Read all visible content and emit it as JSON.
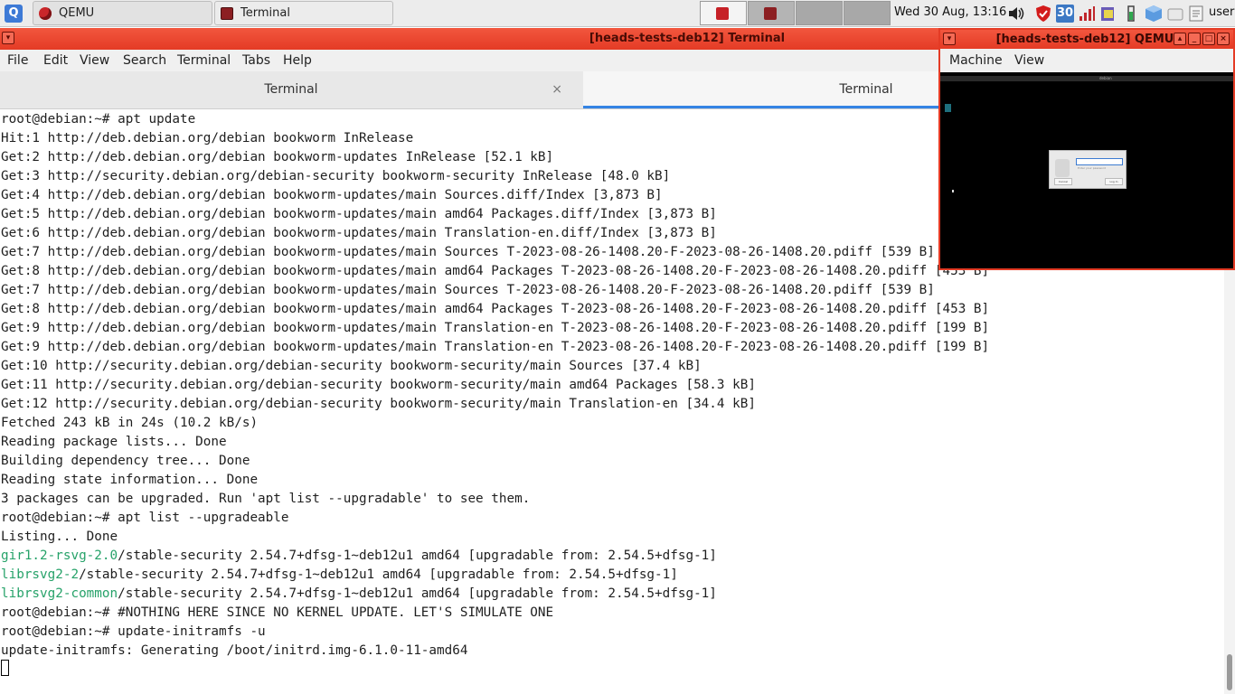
{
  "taskbar": {
    "tasks": [
      {
        "label": "QEMU",
        "icon": "qemu-icon"
      },
      {
        "label": "Terminal",
        "icon": "terminal-icon"
      }
    ],
    "clock": "Wed 30 Aug, 13:16",
    "tray_calendar_day": "30",
    "username": "user",
    "tray_icons": [
      "volume-icon",
      "shield-icon",
      "calendar-icon",
      "signal-bars-icon",
      "clipboard-icon",
      "battery-icon",
      "cube-icon",
      "drive-icon",
      "notes-icon"
    ]
  },
  "terminal": {
    "title": "[heads-tests-deb12] Terminal",
    "menu": [
      "File",
      "Edit",
      "View",
      "Search",
      "Terminal",
      "Tabs",
      "Help"
    ],
    "tabs": [
      {
        "label": "Terminal",
        "close": "×"
      },
      {
        "label": "Terminal"
      }
    ],
    "lines": [
      {
        "text": "root@debian:~# apt update"
      },
      {
        "text": "Hit:1 http://deb.debian.org/debian bookworm InRelease"
      },
      {
        "text": "Get:2 http://deb.debian.org/debian bookworm-updates InRelease [52.1 kB]"
      },
      {
        "text": "Get:3 http://security.debian.org/debian-security bookworm-security InRelease [48.0 kB]"
      },
      {
        "text": "Get:4 http://deb.debian.org/debian bookworm-updates/main Sources.diff/Index [3,873 B]"
      },
      {
        "text": "Get:5 http://deb.debian.org/debian bookworm-updates/main amd64 Packages.diff/Index [3,873 B]"
      },
      {
        "text": "Get:6 http://deb.debian.org/debian bookworm-updates/main Translation-en.diff/Index [3,873 B]"
      },
      {
        "text": "Get:7 http://deb.debian.org/debian bookworm-updates/main Sources T-2023-08-26-1408.20-F-2023-08-26-1408.20.pdiff [539 B]"
      },
      {
        "text": "Get:8 http://deb.debian.org/debian bookworm-updates/main amd64 Packages T-2023-08-26-1408.20-F-2023-08-26-1408.20.pdiff [453 B]"
      },
      {
        "text": "Get:7 http://deb.debian.org/debian bookworm-updates/main Sources T-2023-08-26-1408.20-F-2023-08-26-1408.20.pdiff [539 B]"
      },
      {
        "text": "Get:8 http://deb.debian.org/debian bookworm-updates/main amd64 Packages T-2023-08-26-1408.20-F-2023-08-26-1408.20.pdiff [453 B]"
      },
      {
        "text": "Get:9 http://deb.debian.org/debian bookworm-updates/main Translation-en T-2023-08-26-1408.20-F-2023-08-26-1408.20.pdiff [199 B]"
      },
      {
        "text": "Get:9 http://deb.debian.org/debian bookworm-updates/main Translation-en T-2023-08-26-1408.20-F-2023-08-26-1408.20.pdiff [199 B]"
      },
      {
        "text": "Get:10 http://security.debian.org/debian-security bookworm-security/main Sources [37.4 kB]"
      },
      {
        "text": "Get:11 http://security.debian.org/debian-security bookworm-security/main amd64 Packages [58.3 kB]"
      },
      {
        "text": "Get:12 http://security.debian.org/debian-security bookworm-security/main Translation-en [34.4 kB]"
      },
      {
        "text": "Fetched 243 kB in 24s (10.2 kB/s)"
      },
      {
        "text": "Reading package lists... Done"
      },
      {
        "text": "Building dependency tree... Done"
      },
      {
        "text": "Reading state information... Done"
      },
      {
        "text": "3 packages can be upgraded. Run 'apt list --upgradable' to see them."
      },
      {
        "text": "root@debian:~# apt list --upgradeable"
      },
      {
        "text": "Listing... Done"
      },
      {
        "pkg": "gir1.2-rsvg-2.0",
        "text": "/stable-security 2.54.7+dfsg-1~deb12u1 amd64 [upgradable from: 2.54.5+dfsg-1]"
      },
      {
        "pkg": "librsvg2-2",
        "text": "/stable-security 2.54.7+dfsg-1~deb12u1 amd64 [upgradable from: 2.54.5+dfsg-1]"
      },
      {
        "pkg": "librsvg2-common",
        "text": "/stable-security 2.54.7+dfsg-1~deb12u1 amd64 [upgradable from: 2.54.5+dfsg-1]"
      },
      {
        "text": "root@debian:~# #NOTHING HERE SINCE NO KERNEL UPDATE. LET'S SIMULATE ONE"
      },
      {
        "text": "root@debian:~# update-initramfs -u"
      },
      {
        "text": "update-initramfs: Generating /boot/initrd.img-6.1.0-11-amd64"
      }
    ],
    "colors": {
      "accent": "#3584e4",
      "package": "#26a269",
      "titlebar": "#e43b25"
    }
  },
  "qemu": {
    "title": "[heads-tests-deb12] QEMU",
    "menu": [
      "Machine",
      "View"
    ],
    "guest": {
      "panel_label": "debian",
      "password_hint": "Enter your password",
      "cancel": "Cancel",
      "login": "Log In"
    }
  }
}
